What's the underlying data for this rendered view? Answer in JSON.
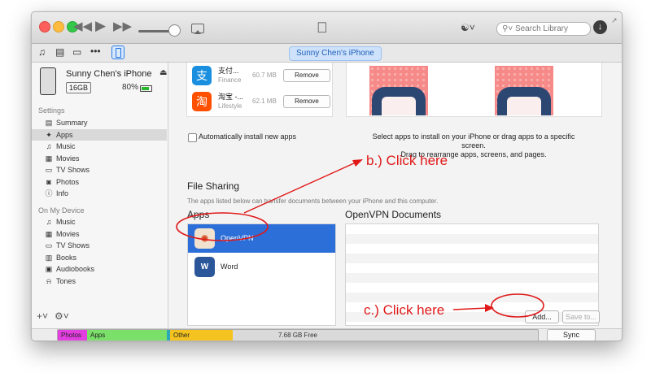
{
  "titlebar": {
    "search_placeholder": "Search Library"
  },
  "toolbar": {
    "device_name": "Sunny Chen's iPhone"
  },
  "sidebar": {
    "device": {
      "name": "Sunny Chen's iPhone",
      "capacity": "16GB",
      "battery_percent": "80%",
      "battery_level": 0.8
    },
    "settings_header": "Settings",
    "settings_items": [
      {
        "label": "Summary",
        "icon": "summary-icon",
        "active": false
      },
      {
        "label": "Apps",
        "icon": "apps-icon",
        "active": true
      },
      {
        "label": "Music",
        "icon": "music-note-icon",
        "active": false
      },
      {
        "label": "Movies",
        "icon": "film-icon",
        "active": false
      },
      {
        "label": "TV Shows",
        "icon": "tv-icon",
        "active": false
      },
      {
        "label": "Photos",
        "icon": "camera-icon",
        "active": false
      },
      {
        "label": "Info",
        "icon": "info-icon",
        "active": false
      }
    ],
    "on_device_header": "On My Device",
    "on_device_items": [
      {
        "label": "Music",
        "icon": "music-note-icon"
      },
      {
        "label": "Movies",
        "icon": "film-icon"
      },
      {
        "label": "TV Shows",
        "icon": "tv-icon"
      },
      {
        "label": "Books",
        "icon": "book-icon"
      },
      {
        "label": "Audiobooks",
        "icon": "audiobook-icon"
      },
      {
        "label": "Tones",
        "icon": "bell-icon"
      }
    ]
  },
  "apps_list": [
    {
      "name": "支付...",
      "category": "Finance",
      "size": "60.7 MB",
      "button": "Remove",
      "icon": "alipay-icon",
      "glyph": "支",
      "color": "#ffffff"
    },
    {
      "name": "淘宝 -...",
      "category": "Lifestyle",
      "size": "62.1 MB",
      "button": "Remove",
      "icon": "taobao-icon",
      "glyph": "淘",
      "color": "#ff4400"
    }
  ],
  "auto_install_label": "Automatically install new apps",
  "screens_help": {
    "line1": "Select apps to install on your iPhone or drag apps to a specific screen.",
    "line2": "Drag to rearrange apps, screens, and pages."
  },
  "file_sharing": {
    "title": "File Sharing",
    "description": "The apps listed below can transfer documents between your iPhone and this computer.",
    "apps_header": "Apps",
    "apps": [
      {
        "name": "OpenVPN",
        "icon": "openvpn-icon",
        "selected": true
      },
      {
        "name": "Word",
        "icon": "word-icon",
        "selected": false
      }
    ],
    "documents_header": "OpenVPN Documents",
    "add_button": "Add...",
    "save_button": "Save to..."
  },
  "storage_bar": {
    "segments": [
      {
        "label": "Photos",
        "color": "#e23ee0"
      },
      {
        "label": "Apps",
        "color": "#7be06a"
      },
      {
        "label": "",
        "color": "#2aa7b8"
      },
      {
        "label": "Other",
        "color": "#f4c31f"
      }
    ],
    "free_label": "7.68 GB Free"
  },
  "sync_button": "Sync",
  "annotations": {
    "b": "b.) Click here",
    "c": "c.) Click here"
  }
}
